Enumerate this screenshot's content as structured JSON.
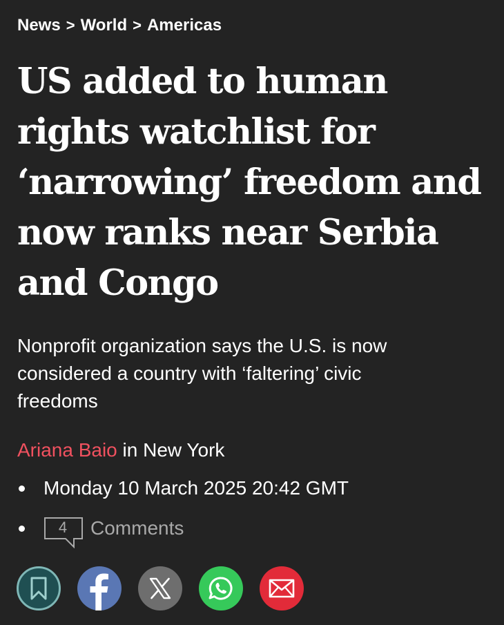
{
  "breadcrumb": {
    "items": [
      "News",
      "World",
      "Americas"
    ],
    "separator": ">"
  },
  "headline": {
    "lines": [
      "US added to human",
      "rights watchlist for",
      "‘narrowing’ freedom and",
      "now ranks near Serbia",
      "and Congo"
    ]
  },
  "standfirst": {
    "lines": [
      "Nonprofit organization says the U.S. is now",
      "considered a country with ‘faltering’ civic",
      "freedoms"
    ]
  },
  "byline": {
    "author": "Ariana Baio",
    "location": " in New York"
  },
  "meta": {
    "date": "Monday 10 March 2025 20:42 GMT",
    "comment_count": "4",
    "comments_label": "Comments"
  },
  "share": {
    "buttons": [
      {
        "name": "bookmark",
        "icon": "bookmark-icon",
        "bg": "#1f4f52",
        "border": "#7fb7b6"
      },
      {
        "name": "facebook",
        "icon": "facebook-icon",
        "bg": "#5a77b4"
      },
      {
        "name": "x",
        "icon": "x-icon",
        "bg": "#6e6e6e"
      },
      {
        "name": "whatsapp",
        "icon": "whatsapp-icon",
        "bg": "#36c95a"
      },
      {
        "name": "email",
        "icon": "mail-icon",
        "bg": "#e22b39"
      }
    ]
  },
  "colors": {
    "background": "#232323",
    "text": "#ffffff",
    "author": "#f0515f",
    "muted": "#a9a9a9"
  }
}
